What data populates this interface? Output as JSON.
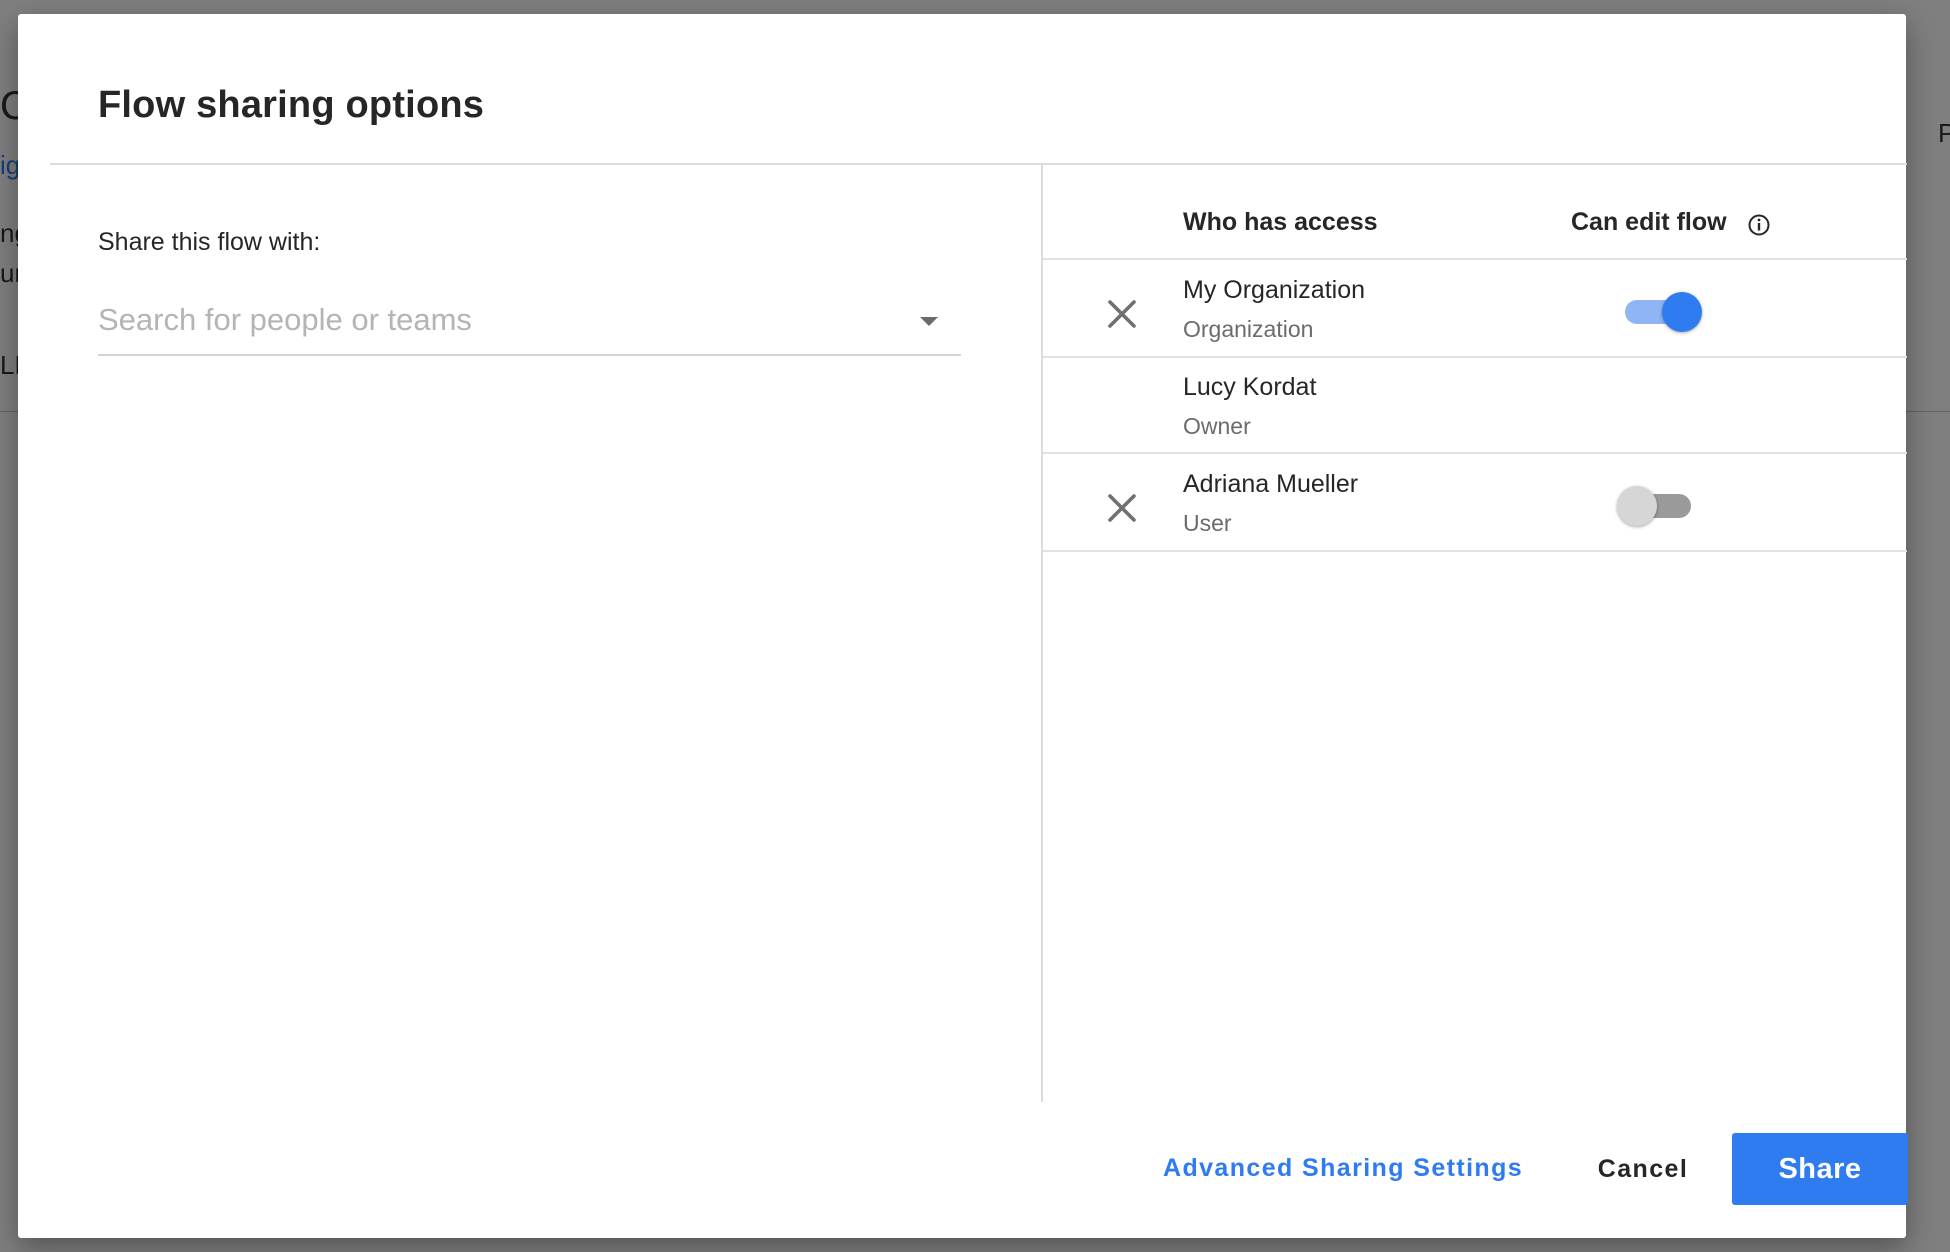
{
  "background": {
    "fragments": [
      "C",
      "ig",
      "ng",
      "ur",
      "LE",
      "P"
    ]
  },
  "dialog": {
    "title": "Flow sharing options",
    "share_label": "Share this flow with:",
    "search": {
      "placeholder": "Search for people or teams",
      "value": ""
    },
    "access_table": {
      "header_who": "Who has access",
      "header_edit": "Can edit flow",
      "rows": [
        {
          "name": "My Organization",
          "role": "Organization",
          "removable": true,
          "can_edit": true
        },
        {
          "name": "Lucy Kordat",
          "role": "Owner",
          "removable": false,
          "can_edit": null
        },
        {
          "name": "Adriana Mueller",
          "role": "User",
          "removable": true,
          "can_edit": false
        }
      ]
    },
    "footer": {
      "advanced_label": "Advanced Sharing Settings",
      "cancel_label": "Cancel",
      "share_label": "Share"
    }
  },
  "icons": {
    "dropdown": "caret-down-icon",
    "info": "info-circle-icon",
    "remove": "close-x-icon"
  },
  "colors": {
    "accent": "#2f7bf0",
    "toggle_on_track": "#8fb5f5",
    "toggle_off_track": "#9a9a9a",
    "toggle_off_knob": "#d6d6d6"
  }
}
